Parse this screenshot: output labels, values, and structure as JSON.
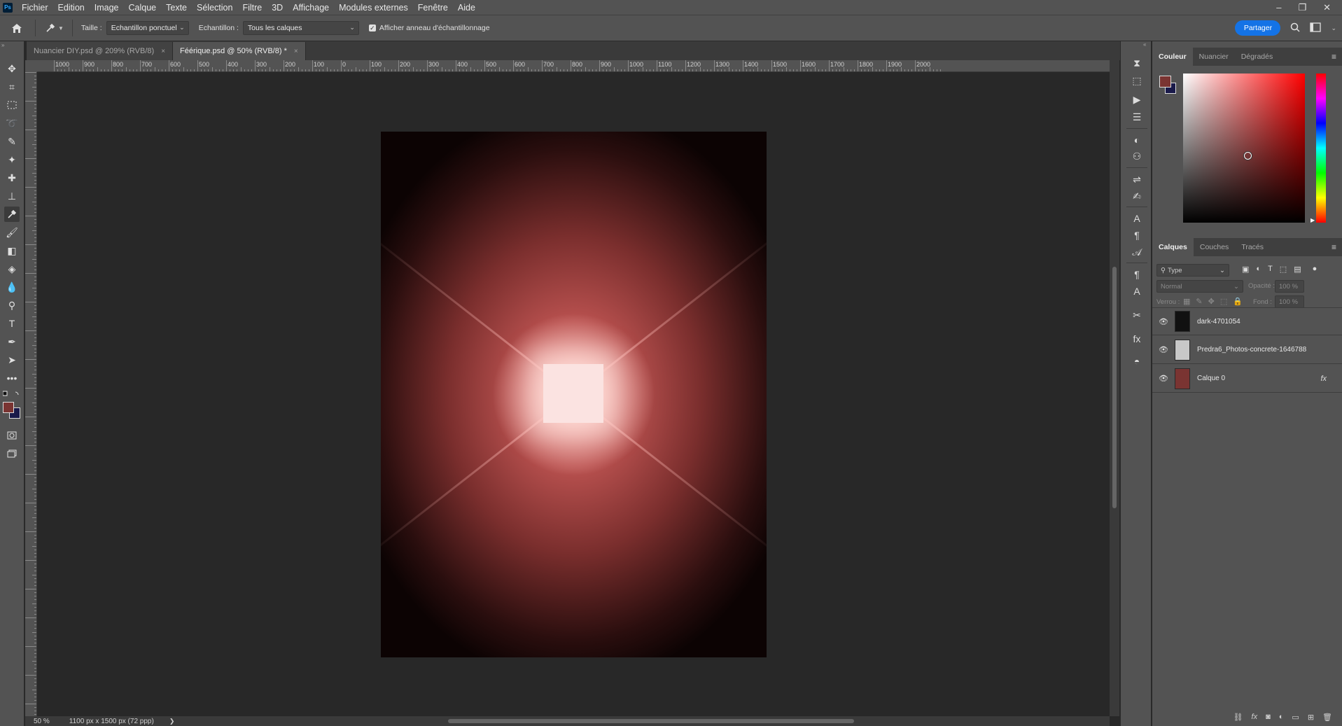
{
  "app": {
    "logo": "Ps"
  },
  "menu": [
    "Fichier",
    "Edition",
    "Image",
    "Calque",
    "Texte",
    "Sélection",
    "Filtre",
    "3D",
    "Affichage",
    "Modules externes",
    "Fenêtre",
    "Aide"
  ],
  "window_controls": {
    "minimize": "–",
    "restore": "❐",
    "close": "✕"
  },
  "options": {
    "size_label": "Taille :",
    "size_value": "Echantillon ponctuel",
    "sample_label": "Echantillon :",
    "sample_value": "Tous les calques",
    "ring_label": "Afficher anneau d'échantillonnage",
    "share": "Partager"
  },
  "tabs": [
    {
      "label": "Nuancier DIY.psd @ 209% (RVB/8)",
      "close": "×"
    },
    {
      "label": "Féérique.psd @ 50% (RVB/8) *",
      "close": "×"
    }
  ],
  "ruler_top": [
    "1000",
    "900",
    "800",
    "700",
    "600",
    "500",
    "400",
    "300",
    "200",
    "100",
    "0",
    "100",
    "200",
    "300",
    "400",
    "500",
    "600",
    "700",
    "800",
    "900",
    "1000",
    "1100",
    "1200",
    "1300",
    "1400",
    "1500",
    "1600",
    "1700",
    "1800",
    "1900",
    "2000"
  ],
  "status": {
    "zoom": "50 %",
    "doc_info": "1100 px x 1500 px (72 ppp)",
    "arrow": "❯"
  },
  "color_panel": {
    "tabs": [
      "Couleur",
      "Nuancier",
      "Dégradés"
    ],
    "foreground": "#7a3432",
    "background": "#1a1a4a",
    "accent": "#1473e6"
  },
  "layers_panel": {
    "tabs": [
      "Calques",
      "Couches",
      "Tracés"
    ],
    "filter": "Type",
    "blend_mode": "Normal",
    "opacity_label": "Opacité :",
    "opacity_value": "100 %",
    "lock_label": "Verrou :",
    "fill_label": "Fond :",
    "fill_value": "100 %",
    "layers": [
      {
        "name": "dark-4701054",
        "visible": true,
        "thumb": "#111111"
      },
      {
        "name": "Predra6_Photos-concrete-1646788",
        "visible": true,
        "thumb": "#c8c8c8"
      },
      {
        "name": "Calque 0",
        "visible": true,
        "thumb": "#7a3432",
        "fx": "fx"
      }
    ]
  }
}
